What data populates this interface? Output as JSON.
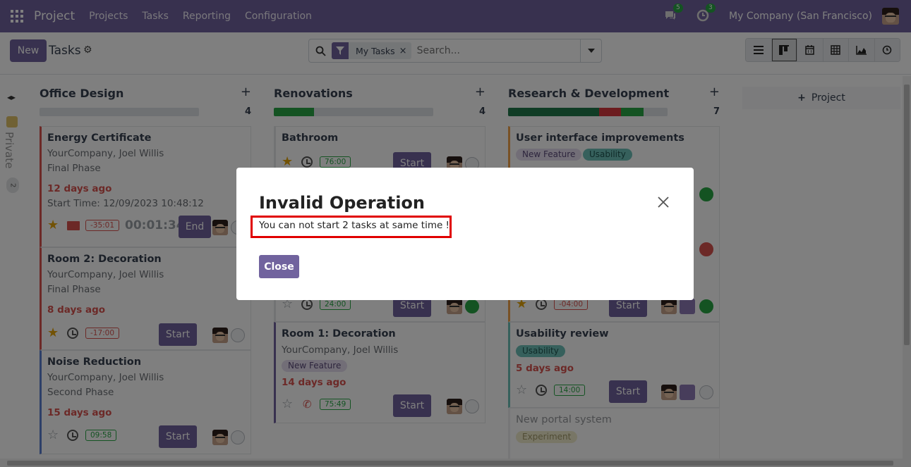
{
  "navbar": {
    "app_name": "Project",
    "menu": [
      "Projects",
      "Tasks",
      "Reporting",
      "Configuration"
    ],
    "messages_count": "5",
    "activities_count": "3",
    "company": "My Company (San Francisco)"
  },
  "control_panel": {
    "new_label": "New",
    "title": "Tasks",
    "facet_label": "My Tasks",
    "search_placeholder": "Search..."
  },
  "folded_column": {
    "label": "Private",
    "count": "2"
  },
  "columns": [
    {
      "title": "Office Design",
      "count": "4",
      "cards": [
        {
          "title": "Energy Certificate",
          "customer": "YourCompany, Joel Willis",
          "stage": "Final Phase",
          "date": "12 days ago",
          "start_time": "Start Time: 12/09/2023 10:48:12",
          "timer": "-35:01",
          "running": "00:01:34",
          "button": "End"
        },
        {
          "title": "Room 2: Decoration",
          "customer": "YourCompany, Joel Willis",
          "stage": "Final Phase",
          "date": "8 days ago",
          "timer": "-17:00",
          "button": "Start"
        },
        {
          "title": "Noise Reduction",
          "customer": "YourCompany, Joel Willis",
          "stage": "Second Phase",
          "date": "15 days ago",
          "timer": "09:58",
          "button": "Start"
        }
      ]
    },
    {
      "title": "Renovations",
      "count": "4",
      "cards": [
        {
          "title": "Bathroom",
          "timer": "76:00",
          "button": "Start"
        },
        {
          "timer": "24:00",
          "button": "Start"
        },
        {
          "title": "Room 1: Decoration",
          "customer": "YourCompany, Joel Willis",
          "tag": "New Feature",
          "date": "14 days ago",
          "timer": "75:49",
          "button": "Start"
        }
      ]
    },
    {
      "title": "Research & Development",
      "count": "7",
      "cards": [
        {
          "title": "User interface improvements",
          "tags": [
            "New Feature",
            "Usability"
          ]
        },
        {
          "timer": "-04:00",
          "button": "Start"
        },
        {
          "title": "Usability review",
          "tag": "Usability",
          "date": "5 days ago",
          "timer": "14:00",
          "button": "Start"
        },
        {
          "title": "New portal system",
          "tag": "Experiment"
        }
      ]
    }
  ],
  "add_project_label": "Project",
  "modal": {
    "title": "Invalid Operation",
    "message": "You can not start 2 tasks at same time !",
    "button": "Close"
  },
  "colors": {
    "brand": "#71639e",
    "danger": "#d9534f",
    "success": "#28a745",
    "highlight_box": "#e00000"
  },
  "progress": {
    "office_design": 0,
    "renovations": {
      "green": 0.25
    },
    "research_development": {
      "green": 0.57,
      "red": 0.14,
      "green2": 0.14
    }
  }
}
